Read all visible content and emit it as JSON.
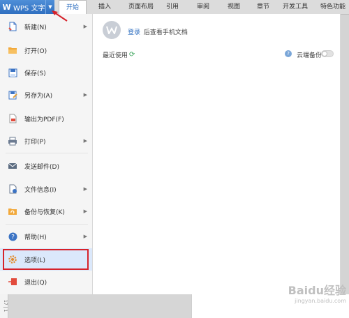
{
  "app": {
    "name": "WPS 文字",
    "logo_letter": "W"
  },
  "tabs": [
    {
      "label": "开始",
      "active": true
    },
    {
      "label": "插入",
      "active": false
    },
    {
      "label": "页面布局",
      "active": false
    },
    {
      "label": "引用",
      "active": false
    },
    {
      "label": "审阅",
      "active": false
    },
    {
      "label": "视图",
      "active": false
    },
    {
      "label": "章节",
      "active": false
    },
    {
      "label": "开发工具",
      "active": false
    },
    {
      "label": "特色功能",
      "active": false
    }
  ],
  "menu": {
    "items": [
      {
        "label": "新建(N)",
        "icon": "new-doc-icon",
        "has_submenu": true
      },
      {
        "label": "打开(O)",
        "icon": "folder-icon",
        "has_submenu": false
      },
      {
        "label": "保存(S)",
        "icon": "save-icon",
        "has_submenu": false
      },
      {
        "label": "另存为(A)",
        "icon": "save-as-icon",
        "has_submenu": true
      },
      {
        "label": "输出为PDF(F)",
        "icon": "pdf-icon",
        "has_submenu": false
      },
      {
        "label": "打印(P)",
        "icon": "printer-icon",
        "has_submenu": true
      },
      {
        "label": "发送邮件(D)",
        "icon": "mail-icon",
        "has_submenu": false
      },
      {
        "label": "文件信息(I)",
        "icon": "file-info-icon",
        "has_submenu": true
      },
      {
        "label": "备份与恢复(K)",
        "icon": "backup-icon",
        "has_submenu": true
      },
      {
        "label": "帮助(H)",
        "icon": "help-icon",
        "has_submenu": true
      },
      {
        "label": "选项(L)",
        "icon": "gear-icon",
        "has_submenu": false,
        "selected": true
      },
      {
        "label": "退出(Q)",
        "icon": "exit-icon",
        "has_submenu": false
      }
    ]
  },
  "panel": {
    "login_link": "登录",
    "login_desc": "后查看手机文档",
    "recent_label": "最近使用",
    "cloud_backup_label": "云端备份",
    "cloud_backup_enabled": false
  },
  "ruler": {
    "label": "17 | 1"
  },
  "watermark": {
    "logo": "Baidu经验",
    "url": "jingyan.baidu.com"
  },
  "colors": {
    "accent": "#2f6fc0",
    "annotation_red": "#d6222a",
    "selected_bg": "#dbe8fb"
  }
}
